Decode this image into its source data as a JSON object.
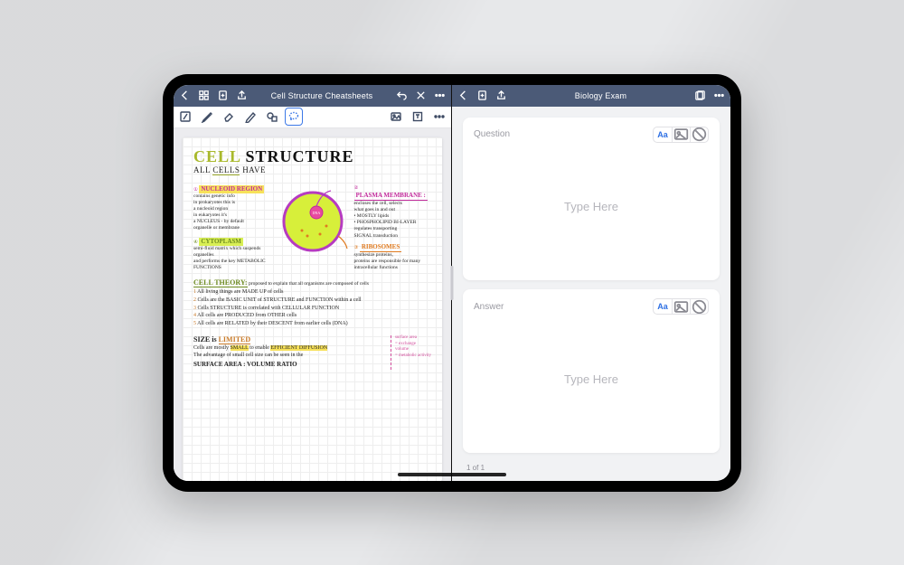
{
  "left": {
    "title": "Cell Structure Cheatsheets",
    "note": {
      "heading_1": "CELL",
      "heading_2": "STRUCTURE",
      "subheading_pre": "ALL",
      "subheading_mid": "CELLS",
      "subheading_post": "HAVE",
      "labels": {
        "nucleoid": "NUCLEOID REGION",
        "plasma": "PLASMA MEMBRANE :",
        "cytoplasm": "CYTOPLASM",
        "ribosomes": "RIBOSOMES",
        "dna": "DNA"
      },
      "notes": {
        "nucleoid": "contains genetic info\nin prokaryotes this is\na nucleoid region\nin eukaryotes it's\na NUCLEUS - by default\n  organelle or membrane",
        "plasma": "encloses the cell, selects\nwhat goes in and out\n• MOSTLY lipids\n• PHOSPHOLIPID BI-LAYER\nregulates transporting\nSIGNAL transduction",
        "cytoplasm": "semi-fluid matrix which suspends organelles\nand performs the key METABOLIC FUNCTIONS",
        "ribosomes": "synthesize proteins,\nproteins are responsible for many\nintracellular functions"
      },
      "theory": {
        "heading": "CELL THEORY:",
        "heading_tail": "proposed to explain that all organisms are composed of cells",
        "items": [
          "All living things are MADE UP of cells",
          "Cells are the BASIC UNIT of STRUCTURE and FUNCTION within a cell",
          "Cells STRUCTURE is correlated with CELLULAR FUNCTION",
          "All cells are PRODUCED from OTHER cells",
          "All cells are RELATED by their DESCENT from earlier cells  (DNA)"
        ]
      },
      "size": {
        "heading_1": "SIZE is",
        "heading_2": "LIMITED",
        "line1_a": "Cells are mostly",
        "line1_b": "SMALL",
        "line1_c": "to enable",
        "line1_d": "EFFICIENT DIFFUSION",
        "line2": "The advantage of small cell size can be seen in the",
        "final": "SURFACE AREA : VOLUME RATIO",
        "aside": "surface area\n= exchange\nvolume\n= metabolic activity"
      }
    }
  },
  "right": {
    "title": "Biology Exam",
    "question_label": "Question",
    "answer_label": "Answer",
    "placeholder": "Type Here",
    "text_tool_label": "Aa",
    "page_indicator": "1 of 1"
  }
}
